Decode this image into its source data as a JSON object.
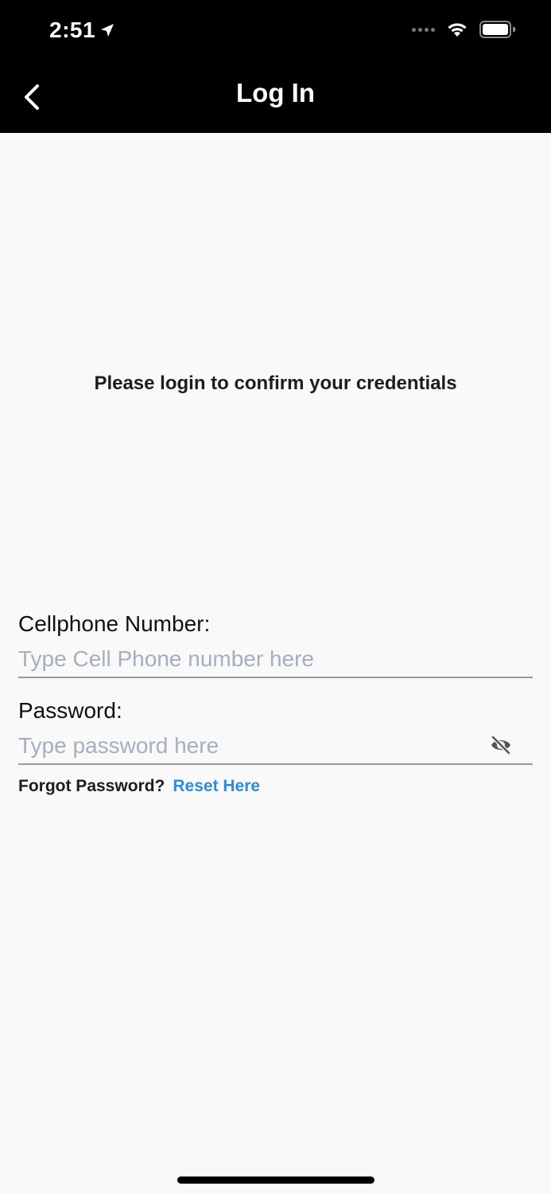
{
  "status_bar": {
    "time": "2:51",
    "icons": [
      "location-arrow-icon",
      "signal-dots-icon",
      "wifi-icon",
      "battery-icon"
    ]
  },
  "nav": {
    "back_icon": "chevron-left-icon",
    "title": "Log In"
  },
  "main": {
    "prompt": "Please login to confirm your credentials",
    "phone": {
      "label": "Cellphone Number:",
      "placeholder": "Type Cell Phone number here",
      "value": ""
    },
    "password": {
      "label": "Password:",
      "placeholder": "Type password here",
      "value": "",
      "toggle_icon": "eye-off-icon"
    },
    "forgot": {
      "text": "Forgot Password?",
      "link_label": "Reset Here"
    }
  },
  "colors": {
    "topbar_bg": "#000000",
    "page_bg": "#f9f9f9",
    "link": "#2a8de0",
    "placeholder": "#a4b0bd",
    "underline": "#9a9a9a"
  }
}
